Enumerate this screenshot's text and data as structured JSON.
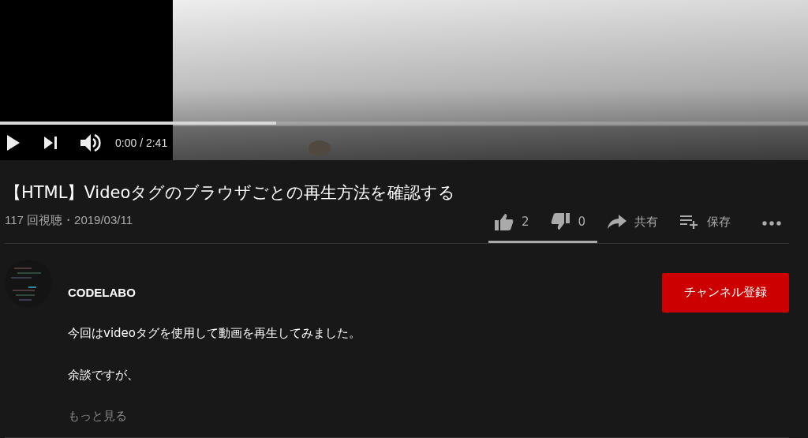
{
  "player": {
    "progress": {
      "level": 0.342
    },
    "time": "0:00 / 2:41"
  },
  "video": {
    "title": "【HTML】Videoタグのブラウザごとの再生方法を確認する",
    "meta": "117 回視聴・2019/03/11"
  },
  "actions": [
    {
      "kind": "like",
      "label": "2"
    },
    {
      "kind": "dislike",
      "label": "0"
    },
    {
      "kind": "share",
      "label": "共有"
    },
    {
      "kind": "save",
      "label": "保存"
    },
    {
      "kind": "more"
    }
  ],
  "sentiment": {
    "level": 1
  },
  "channel": {
    "name": "CODELABO",
    "subscribe": "チャンネル登録"
  },
  "description": [
    "今回はvideoタグを使用して動画を再生してみました。",
    "余談ですが、"
  ],
  "more": "もっと見る"
}
